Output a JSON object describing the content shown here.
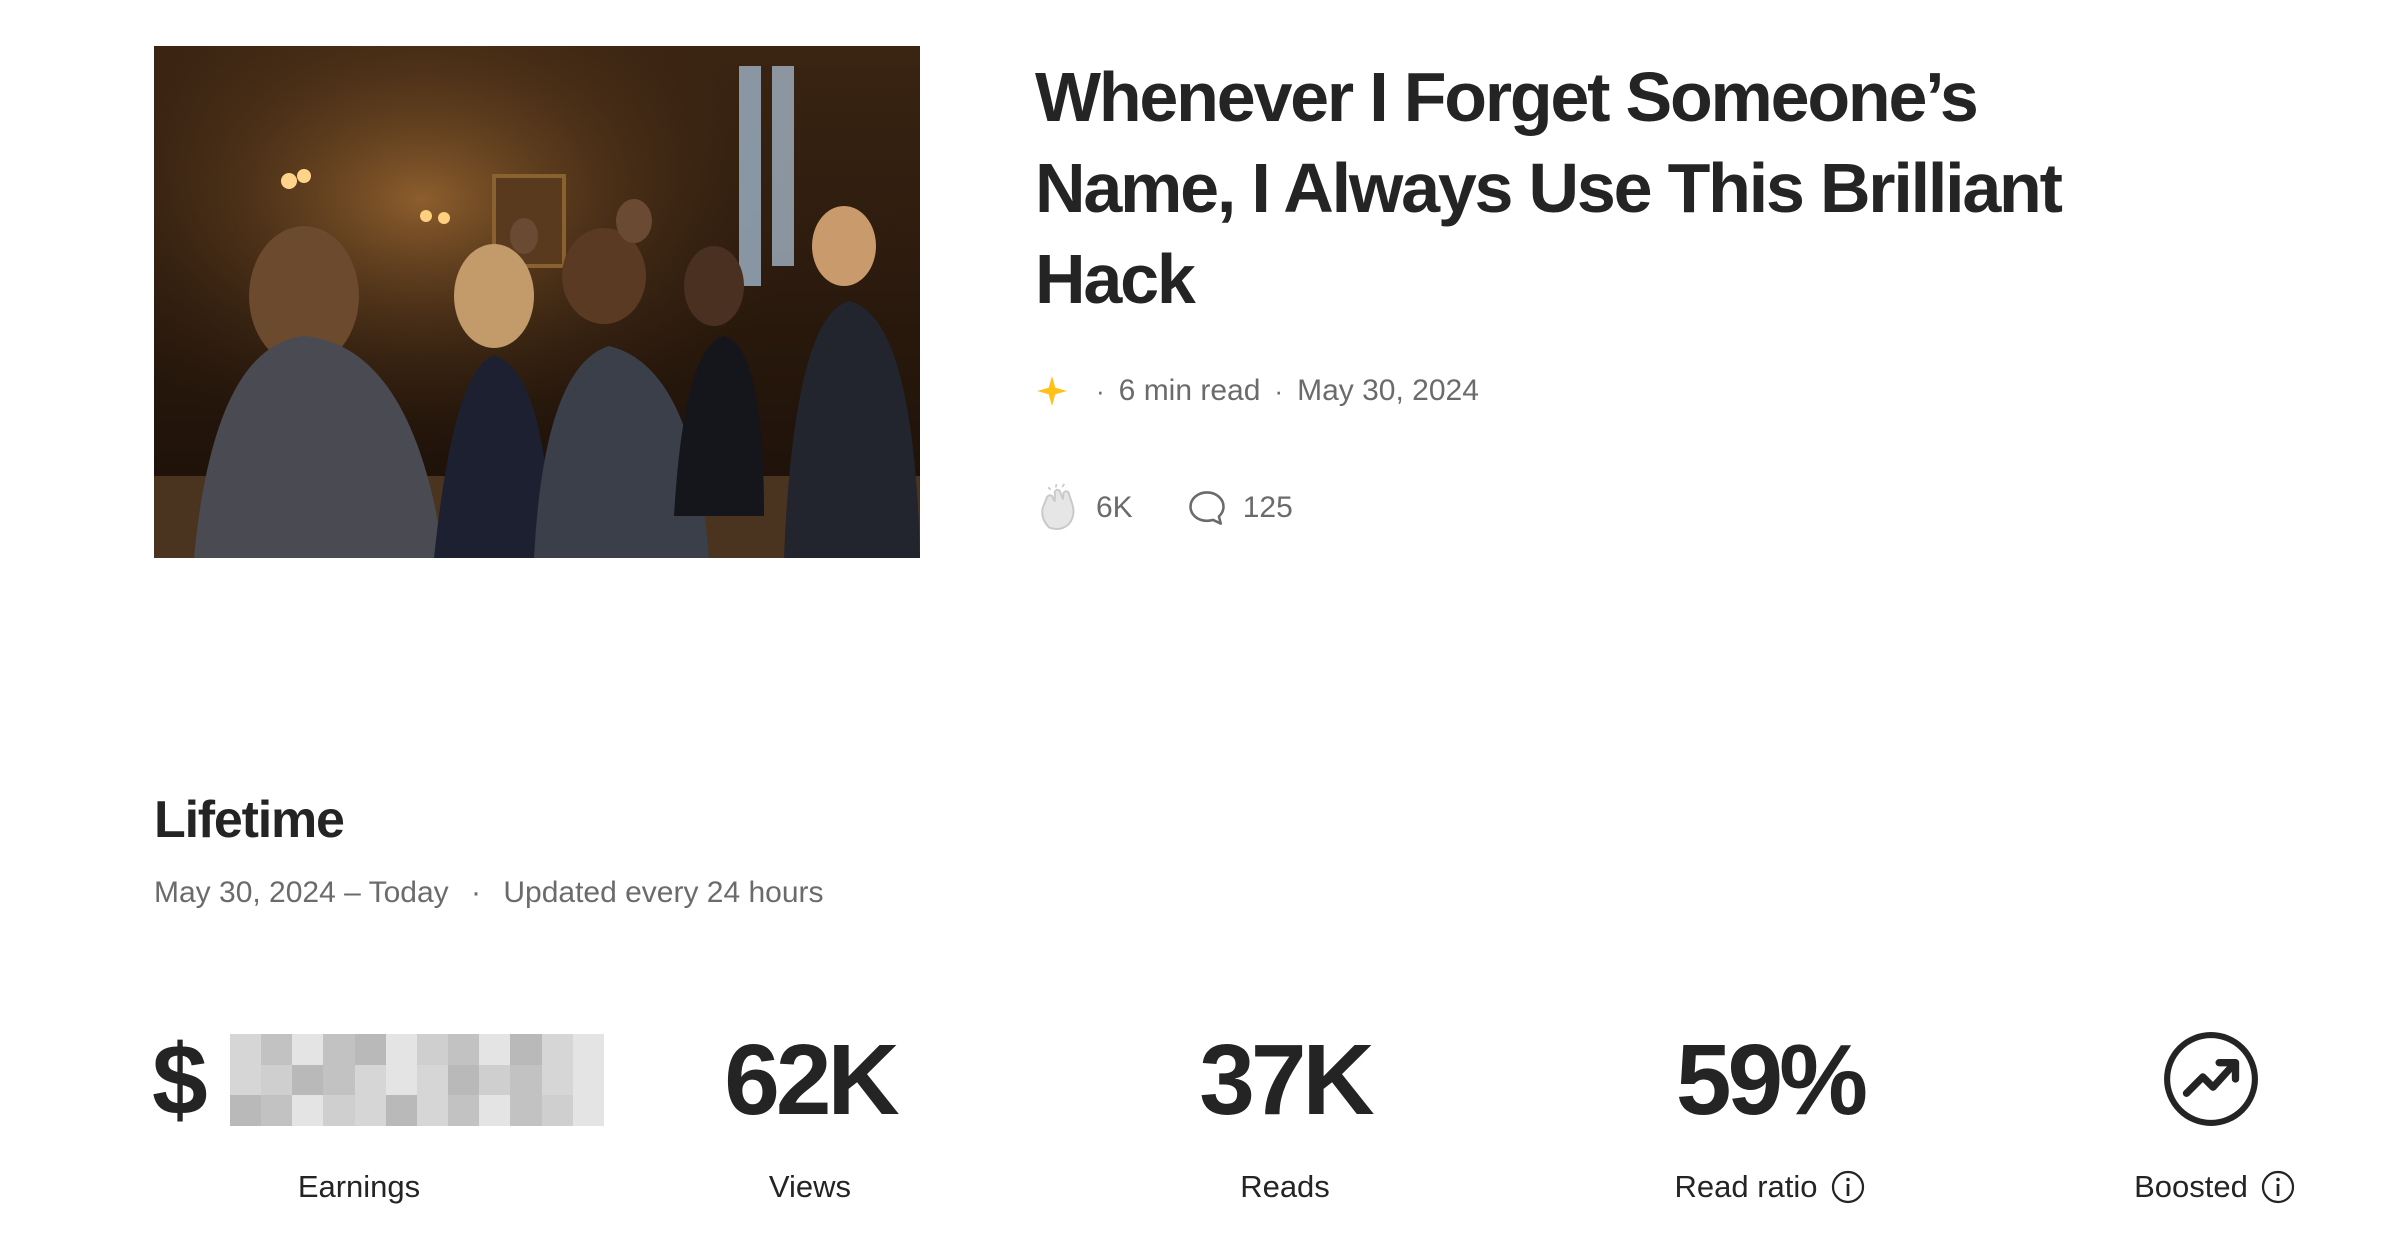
{
  "article": {
    "title": "Whenever I Forget Someone’s Name, I Always Use This Brilliant Hack",
    "member_only_icon": "star-icon",
    "read_time": "6 min read",
    "date": "May 30, 2024",
    "claps": "6K",
    "responses": "125",
    "accent_color": "#ffc017"
  },
  "lifetime": {
    "title": "Lifetime",
    "range": "May 30, 2024 – Today",
    "updated": "Updated every 24 hours"
  },
  "stats": {
    "earnings": {
      "currency": "$",
      "value_hidden": true,
      "label": "Earnings"
    },
    "views": {
      "value": "62K",
      "label": "Views"
    },
    "reads": {
      "value": "37K",
      "label": "Reads"
    },
    "read_ratio": {
      "value": "59%",
      "label": "Read ratio"
    },
    "boosted": {
      "icon": "trending-up-icon",
      "label": "Boosted"
    }
  }
}
